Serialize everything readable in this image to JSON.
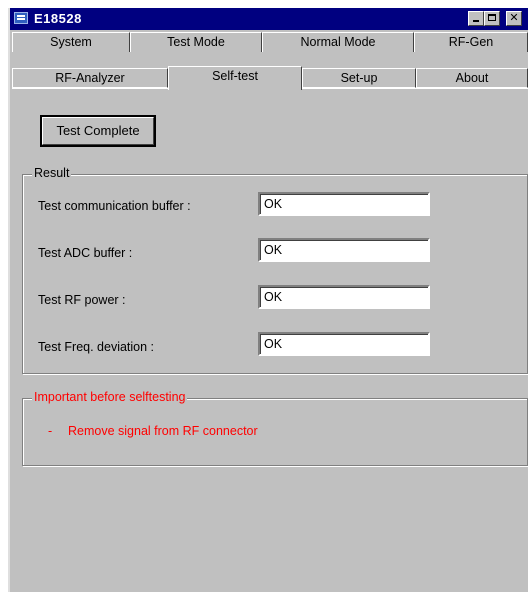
{
  "window": {
    "title": "E18528"
  },
  "tabs": {
    "row1": [
      "System",
      "Test Mode",
      "Normal Mode",
      "RF-Gen"
    ],
    "row2": [
      "RF-Analyzer",
      "Self-test",
      "Set-up",
      "About"
    ],
    "active": "Self-test"
  },
  "action_button": {
    "label": "Test Complete"
  },
  "result": {
    "title": "Result",
    "rows": [
      {
        "label": "Test communication buffer :",
        "value": "OK"
      },
      {
        "label": "Test ADC buffer :",
        "value": "OK"
      },
      {
        "label": "Test RF power :",
        "value": "OK"
      },
      {
        "label": "Test Freq. deviation :",
        "value": "OK"
      }
    ]
  },
  "notice": {
    "title": "Important before selftesting",
    "bullet": "-",
    "text": "Remove signal from RF connector"
  },
  "colors": {
    "titlebar": "#000080",
    "face": "#c0c0c0",
    "warning": "#ff0000"
  }
}
